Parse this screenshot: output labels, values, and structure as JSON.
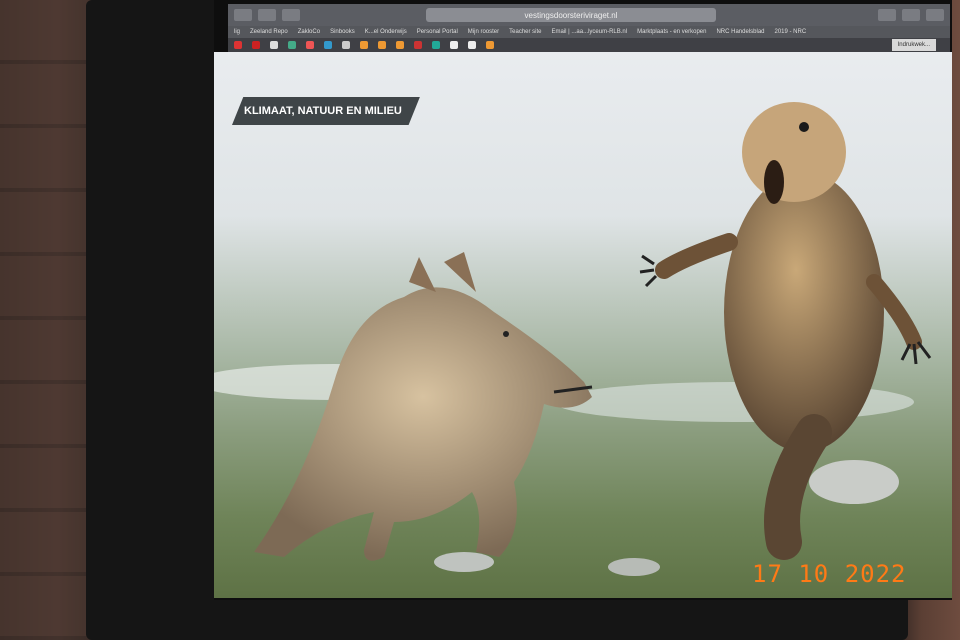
{
  "browser": {
    "url": "vestingsdoorsteriviraget.nl",
    "bookmarks": [
      "lig",
      "Zeeland Repo",
      "ZakloCo",
      "Sinbooks",
      "K...el Onderwijs",
      "Personal Portal",
      "Mijn rooster",
      "Teacher site",
      "Email | ...aa...lyceum-RLB.nl",
      "Marktplaats - en verkopen",
      "NRC Handelsblad",
      "2019 - NRC"
    ],
    "active_tab": "Indrukwek..."
  },
  "article": {
    "category": "KLIMAAT, NATUUR EN MILIEU"
  },
  "photo_timestamp": "17 10 2022",
  "colors": {
    "label_bg": "#3f4548",
    "timestamp": "#ff7a16"
  }
}
